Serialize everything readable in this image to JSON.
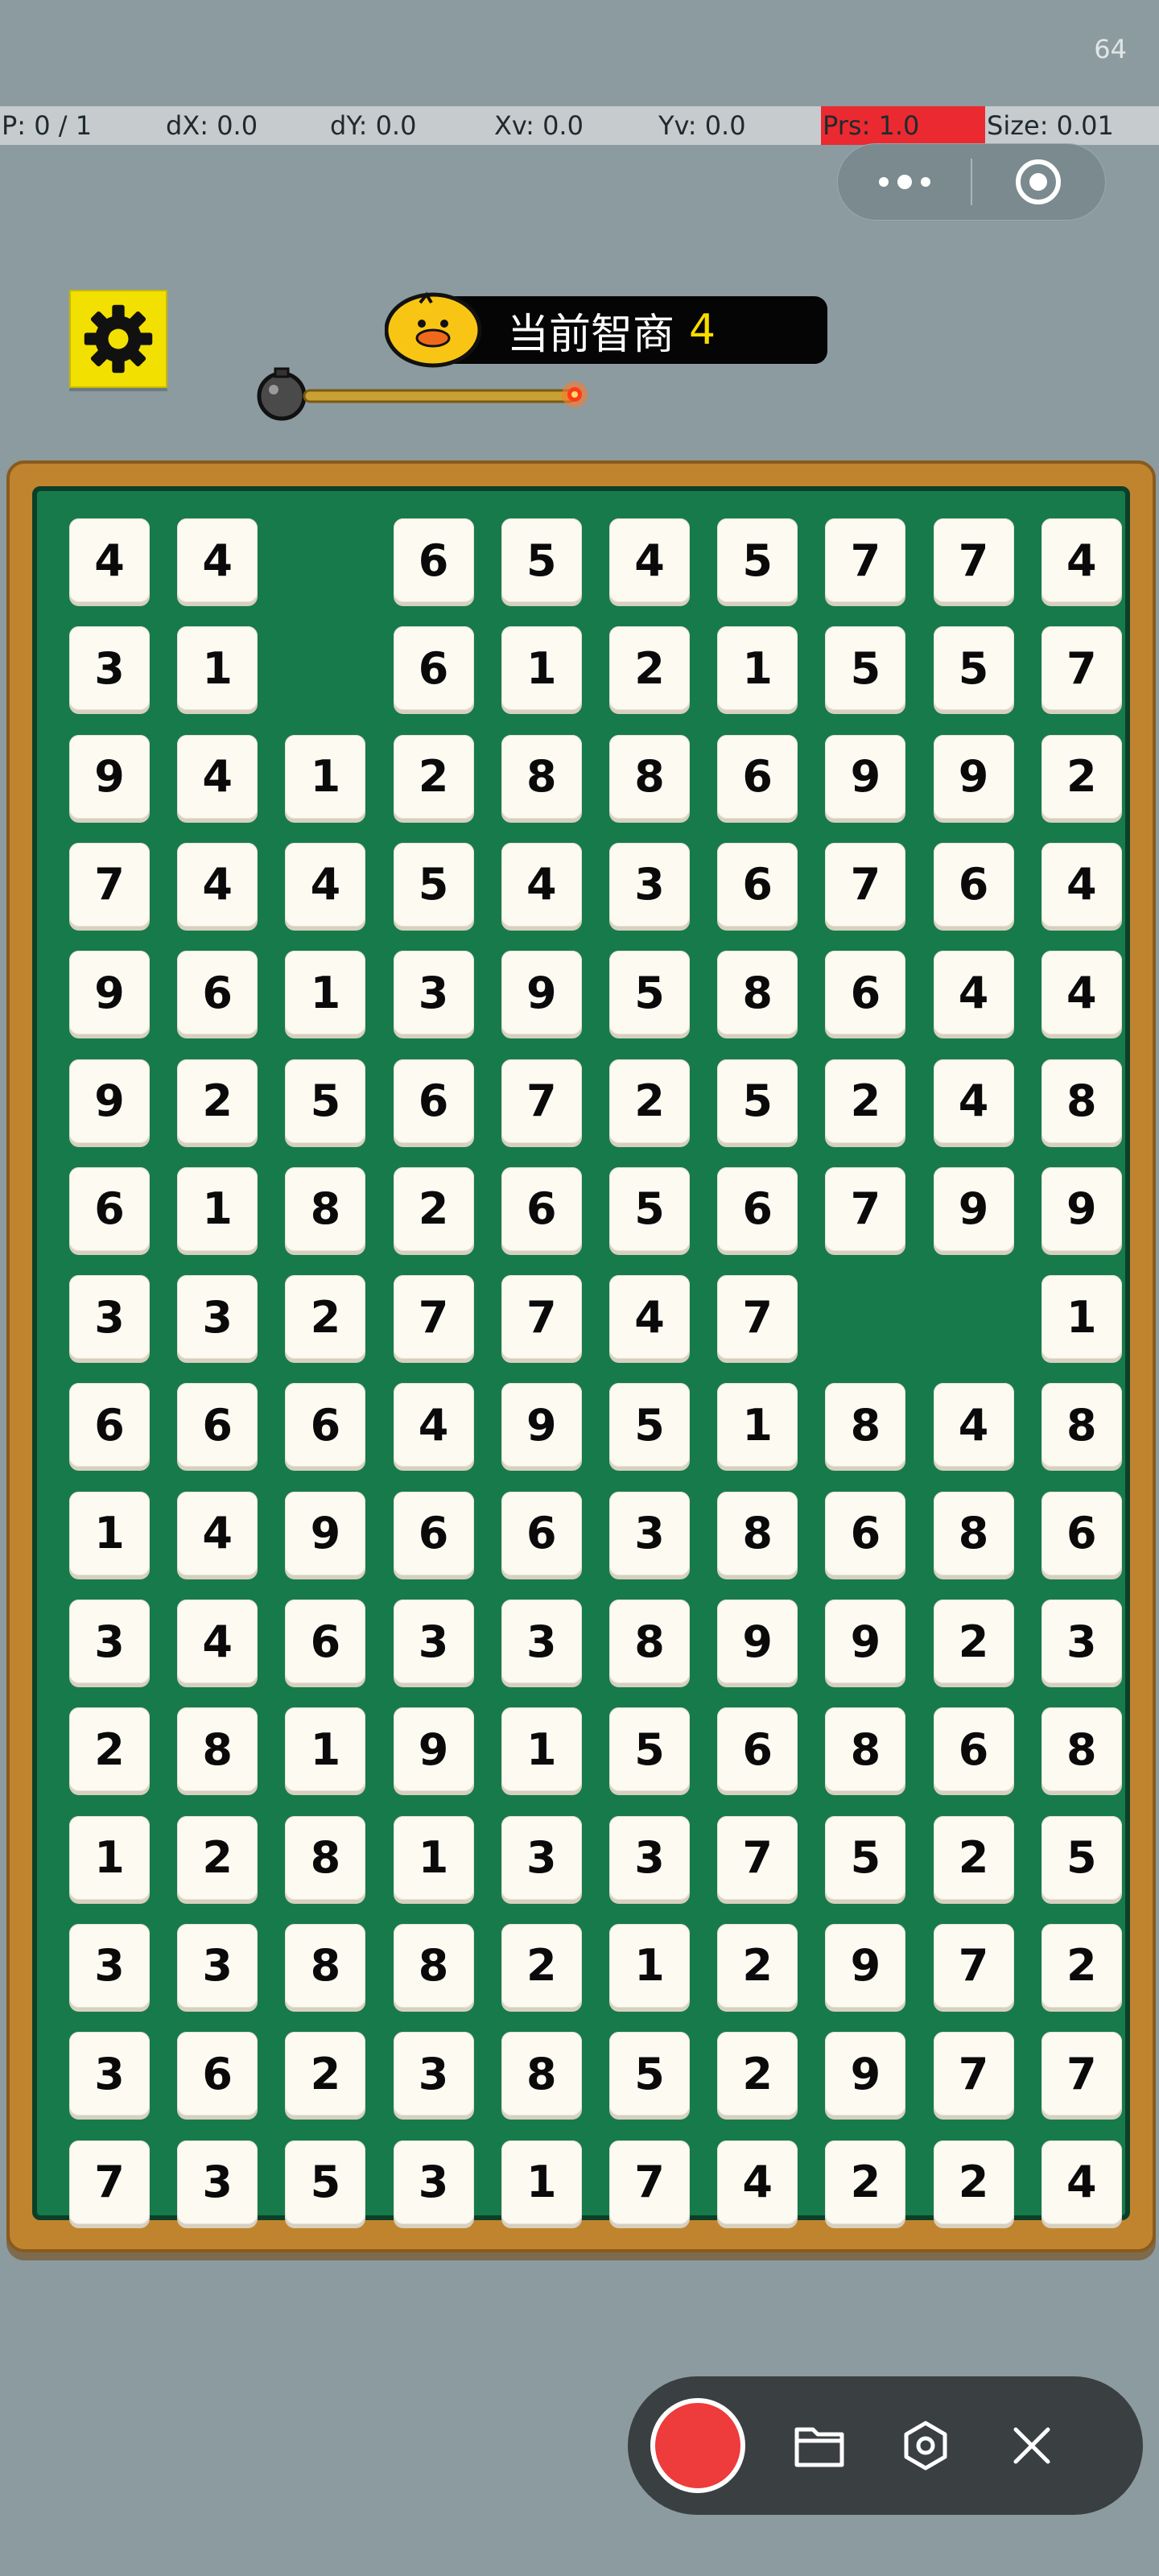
{
  "debug": {
    "fps": "64",
    "fields": [
      "P: 0 / 1",
      "dX: 0.0",
      "dY: 0.0",
      "Xv: 0.0",
      "Yv: 0.0",
      "Prs: 1.0",
      "Size: 0.01"
    ]
  },
  "capsule": {
    "more_icon": "more-dots-icon",
    "close_icon": "target-circle-icon"
  },
  "toolbar": {
    "settings_icon": "gear-icon"
  },
  "score": {
    "label": "当前智商",
    "value": "4"
  },
  "timer": {
    "fuse_remaining": 1.0
  },
  "board": {
    "rows": [
      [
        "4",
        "4",
        "",
        "6",
        "5",
        "4",
        "5",
        "7",
        "7",
        "4"
      ],
      [
        "3",
        "1",
        "",
        "6",
        "1",
        "2",
        "1",
        "5",
        "5",
        "7"
      ],
      [
        "9",
        "4",
        "1",
        "2",
        "8",
        "8",
        "6",
        "9",
        "9",
        "2"
      ],
      [
        "7",
        "4",
        "4",
        "5",
        "4",
        "3",
        "6",
        "7",
        "6",
        "4"
      ],
      [
        "9",
        "6",
        "1",
        "3",
        "9",
        "5",
        "8",
        "6",
        "4",
        "4"
      ],
      [
        "9",
        "2",
        "5",
        "6",
        "7",
        "2",
        "5",
        "2",
        "4",
        "8"
      ],
      [
        "6",
        "1",
        "8",
        "2",
        "6",
        "5",
        "6",
        "7",
        "9",
        "9"
      ],
      [
        "3",
        "3",
        "2",
        "7",
        "7",
        "4",
        "7",
        "",
        "",
        "1"
      ],
      [
        "6",
        "6",
        "6",
        "4",
        "9",
        "5",
        "1",
        "8",
        "4",
        "8"
      ],
      [
        "1",
        "4",
        "9",
        "6",
        "6",
        "3",
        "8",
        "6",
        "8",
        "6"
      ],
      [
        "3",
        "4",
        "6",
        "3",
        "3",
        "8",
        "9",
        "9",
        "2",
        "3"
      ],
      [
        "2",
        "8",
        "1",
        "9",
        "1",
        "5",
        "6",
        "8",
        "6",
        "8"
      ],
      [
        "1",
        "2",
        "8",
        "1",
        "3",
        "3",
        "7",
        "5",
        "2",
        "5"
      ],
      [
        "3",
        "3",
        "8",
        "8",
        "2",
        "1",
        "2",
        "9",
        "7",
        "2"
      ],
      [
        "3",
        "6",
        "2",
        "3",
        "8",
        "5",
        "2",
        "9",
        "7",
        "7"
      ],
      [
        "7",
        "3",
        "5",
        "3",
        "1",
        "7",
        "4",
        "2",
        "2",
        "4"
      ]
    ]
  },
  "recorder": {
    "icons": [
      "record-button",
      "folder-icon",
      "hexagon-settings-icon",
      "close-icon"
    ]
  },
  "colors": {
    "felt": "#177a4b",
    "frame": "#c0842f",
    "settings_bg": "#f2e000",
    "record": "#ee3b3b"
  }
}
